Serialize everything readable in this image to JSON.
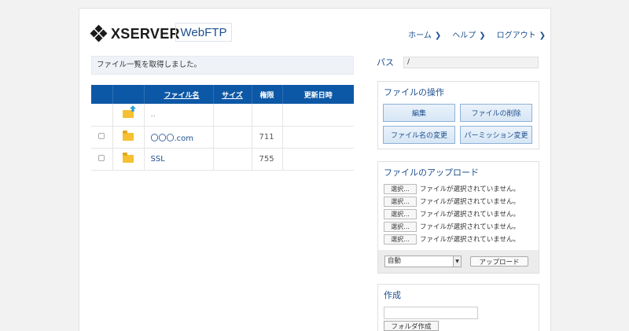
{
  "header": {
    "logo_text": "XSERVER",
    "product_label": "WebFTP",
    "nav": [
      {
        "label": "ホーム",
        "icon": "chevron-right-icon"
      },
      {
        "label": "ヘルプ",
        "icon": "chevron-right-icon"
      },
      {
        "label": "ログアウト",
        "icon": "chevron-right-icon"
      }
    ]
  },
  "status_message": "ファイル一覧を取得しました。",
  "file_table": {
    "columns": [
      "ファイル名",
      "サイズ",
      "権限",
      "更新日時"
    ],
    "rows": [
      {
        "name": "..",
        "size": "",
        "permission": "",
        "modified": "",
        "icon": "parent-folder-icon"
      },
      {
        "name": "〇〇〇.com",
        "size": "",
        "permission": "711",
        "modified": "",
        "icon": "folder-icon"
      },
      {
        "name": "SSL",
        "size": "",
        "permission": "755",
        "modified": "",
        "icon": "folder-icon"
      }
    ]
  },
  "path": {
    "label": "パス",
    "value": "/"
  },
  "file_ops": {
    "title": "ファイルの操作",
    "buttons": [
      "編集",
      "ファイルの削除",
      "ファイル名の変更",
      "パーミッション変更"
    ]
  },
  "upload": {
    "title": "ファイルのアップロード",
    "choose_label": "選択...",
    "no_file_text": "ファイルが選択されていません。",
    "slots": 5,
    "mode_value": "自動",
    "upload_button": "アップロード"
  },
  "create": {
    "title": "作成",
    "input_value": "",
    "folder_button": "フォルダ作成"
  },
  "colors": {
    "header_blue": "#0d58a6",
    "link_blue": "#1d4f8e",
    "folder_yellow": "#f5c032"
  }
}
